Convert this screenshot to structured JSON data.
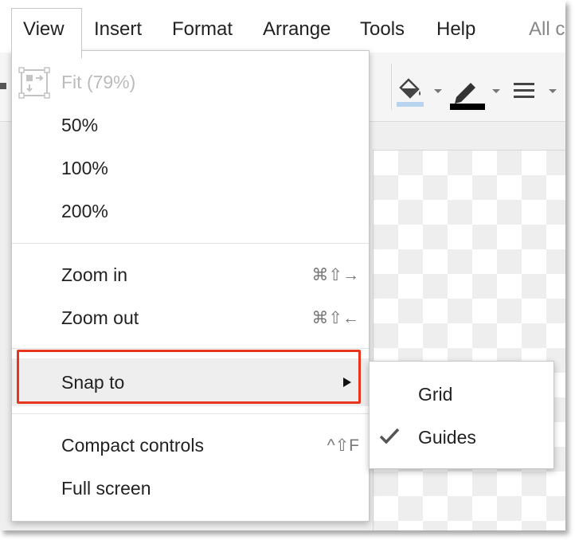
{
  "menubar": {
    "items": [
      {
        "label": "View"
      },
      {
        "label": "Insert"
      },
      {
        "label": "Format"
      },
      {
        "label": "Arrange"
      },
      {
        "label": "Tools"
      },
      {
        "label": "Help"
      },
      {
        "label": "All c"
      }
    ]
  },
  "toolbar": {
    "icons": [
      "fill-color-icon",
      "line-color-icon",
      "line-weight-icon"
    ]
  },
  "view_menu": {
    "fit_label": "Fit (79%)",
    "zoom_50": "50%",
    "zoom_100": "100%",
    "zoom_200": "200%",
    "zoom_in": {
      "label": "Zoom in",
      "shortcut": "⌘⇧→"
    },
    "zoom_out": {
      "label": "Zoom out",
      "shortcut": "⌘⇧←"
    },
    "snap_to": {
      "label": "Snap to"
    },
    "compact_controls": {
      "label": "Compact controls",
      "shortcut": "^⇧F"
    },
    "full_screen": {
      "label": "Full screen"
    }
  },
  "snap_submenu": {
    "items": [
      {
        "label": "Grid",
        "checked": false
      },
      {
        "label": "Guides",
        "checked": true
      }
    ]
  },
  "colors": {
    "highlight_border": "#e8361e",
    "fill_swatch": "#b8d3ee",
    "line_swatch": "#000000"
  }
}
